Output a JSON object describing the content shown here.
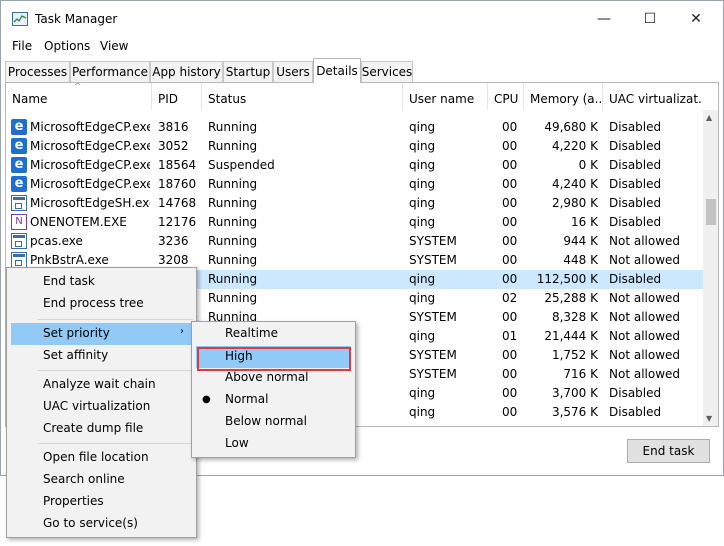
{
  "window": {
    "title": "Task Manager",
    "minimize": "—",
    "maximize": "☐",
    "close": "✕"
  },
  "menu": [
    "File",
    "Options",
    "View"
  ],
  "tabs": [
    "Processes",
    "Performance",
    "App history",
    "Startup",
    "Users",
    "Details",
    "Services"
  ],
  "active_tab": "Details",
  "columns": [
    "Name",
    "PID",
    "Status",
    "User name",
    "CPU",
    "Memory (a...",
    "UAC virtualizat..."
  ],
  "rows": [
    {
      "icon": "edge-icon",
      "name": "MicrosoftEdgeCP.exe",
      "pid": "3816",
      "status": "Running",
      "user": "qing",
      "cpu": "00",
      "mem": "49,680 K",
      "uac": "Disabled"
    },
    {
      "icon": "edge-icon",
      "name": "MicrosoftEdgeCP.exe",
      "pid": "3052",
      "status": "Running",
      "user": "qing",
      "cpu": "00",
      "mem": "4,220 K",
      "uac": "Disabled"
    },
    {
      "icon": "edge-icon",
      "name": "MicrosoftEdgeCP.exe",
      "pid": "18564",
      "status": "Suspended",
      "user": "qing",
      "cpu": "00",
      "mem": "0 K",
      "uac": "Disabled"
    },
    {
      "icon": "edge-icon",
      "name": "MicrosoftEdgeCP.exe",
      "pid": "18760",
      "status": "Running",
      "user": "qing",
      "cpu": "00",
      "mem": "4,240 K",
      "uac": "Disabled"
    },
    {
      "icon": "app-icon",
      "name": "MicrosoftEdgeSH.exe",
      "pid": "14768",
      "status": "Running",
      "user": "qing",
      "cpu": "00",
      "mem": "2,980 K",
      "uac": "Disabled"
    },
    {
      "icon": "onenote-icon",
      "name": "ONENOTEM.EXE",
      "pid": "12176",
      "status": "Running",
      "user": "qing",
      "cpu": "00",
      "mem": "16 K",
      "uac": "Disabled"
    },
    {
      "icon": "app-icon",
      "name": "pcas.exe",
      "pid": "3236",
      "status": "Running",
      "user": "SYSTEM",
      "cpu": "00",
      "mem": "944 K",
      "uac": "Not allowed"
    },
    {
      "icon": "app-icon",
      "name": "PnkBstrA.exe",
      "pid": "3208",
      "status": "Running",
      "user": "SYSTEM",
      "cpu": "00",
      "mem": "448 K",
      "uac": "Not allowed"
    },
    {
      "icon": "",
      "name": "",
      "pid": "",
      "status": "Running",
      "user": "qing",
      "cpu": "00",
      "mem": "112,500 K",
      "uac": "Disabled"
    },
    {
      "icon": "",
      "name": "",
      "pid": "",
      "status": "Running",
      "user": "qing",
      "cpu": "02",
      "mem": "25,288 K",
      "uac": "Not allowed"
    },
    {
      "icon": "",
      "name": "",
      "pid": "",
      "status": "Running",
      "user": "SYSTEM",
      "cpu": "00",
      "mem": "8,328 K",
      "uac": "Not allowed"
    },
    {
      "icon": "",
      "name": "",
      "pid": "",
      "status": "",
      "user": "qing",
      "cpu": "01",
      "mem": "21,444 K",
      "uac": "Not allowed"
    },
    {
      "icon": "",
      "name": "",
      "pid": "",
      "status": "",
      "user": "SYSTEM",
      "cpu": "00",
      "mem": "1,752 K",
      "uac": "Not allowed"
    },
    {
      "icon": "",
      "name": "",
      "pid": "",
      "status": "",
      "user": "SYSTEM",
      "cpu": "00",
      "mem": "716 K",
      "uac": "Not allowed"
    },
    {
      "icon": "",
      "name": "",
      "pid": "",
      "status": "",
      "user": "qing",
      "cpu": "00",
      "mem": "3,700 K",
      "uac": "Disabled"
    },
    {
      "icon": "",
      "name": "",
      "pid": "",
      "status": "",
      "user": "qing",
      "cpu": "00",
      "mem": "3,576 K",
      "uac": "Disabled"
    }
  ],
  "selected_row": 8,
  "end_task_button": "End task",
  "context_menu": {
    "groups": [
      [
        "End task",
        "End process tree"
      ],
      [
        "Set priority",
        "Set affinity"
      ],
      [
        "Analyze wait chain",
        "UAC virtualization",
        "Create dump file"
      ],
      [
        "Open file location",
        "Search online",
        "Properties",
        "Go to service(s)"
      ]
    ],
    "highlighted": "Set priority",
    "submenu_arrow": "›"
  },
  "priority_submenu": {
    "items": [
      "Realtime",
      "High",
      "Above normal",
      "Normal",
      "Below normal",
      "Low"
    ],
    "highlighted": "High",
    "checked": "Normal",
    "check_glyph": "●"
  },
  "colors": {
    "selection": "#cce8ff",
    "menu_highlight": "#91c9f7",
    "annotation_box": "#e0393e"
  }
}
